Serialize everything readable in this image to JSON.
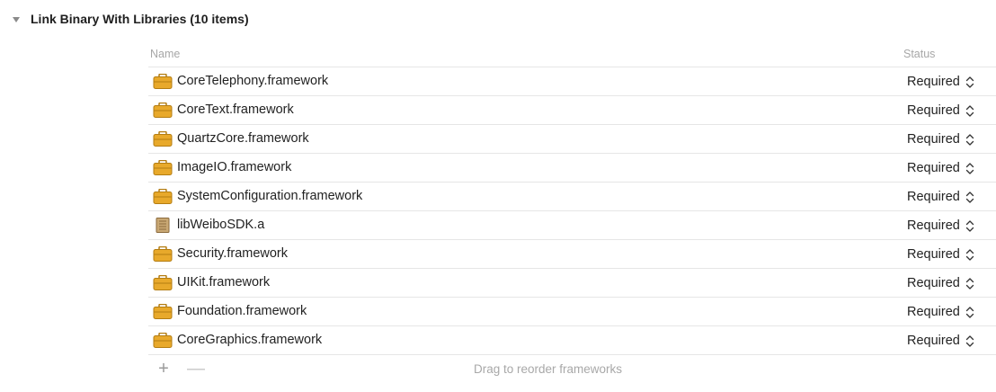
{
  "section": {
    "title": "Link Binary With Libraries (10 items)"
  },
  "table": {
    "headers": {
      "name": "Name",
      "status": "Status"
    },
    "rows": [
      {
        "name": "CoreTelephony.framework",
        "status": "Required",
        "icon": "framework-icon"
      },
      {
        "name": "CoreText.framework",
        "status": "Required",
        "icon": "framework-icon"
      },
      {
        "name": "QuartzCore.framework",
        "status": "Required",
        "icon": "framework-icon"
      },
      {
        "name": "ImageIO.framework",
        "status": "Required",
        "icon": "framework-icon"
      },
      {
        "name": "SystemConfiguration.framework",
        "status": "Required",
        "icon": "framework-icon"
      },
      {
        "name": "libWeiboSDK.a",
        "status": "Required",
        "icon": "library-icon"
      },
      {
        "name": "Security.framework",
        "status": "Required",
        "icon": "framework-icon"
      },
      {
        "name": "UIKit.framework",
        "status": "Required",
        "icon": "framework-icon"
      },
      {
        "name": "Foundation.framework",
        "status": "Required",
        "icon": "framework-icon"
      },
      {
        "name": "CoreGraphics.framework",
        "status": "Required",
        "icon": "framework-icon"
      }
    ]
  },
  "footer": {
    "add_label": "+",
    "remove_label": "—",
    "hint": "Drag to reorder frameworks"
  },
  "colors": {
    "framework_icon": "#e8a92b",
    "framework_icon_dark": "#b47d12",
    "library_icon": "#c9a874",
    "separator": "#e6e6e6",
    "header_text": "#a7a7a7"
  }
}
